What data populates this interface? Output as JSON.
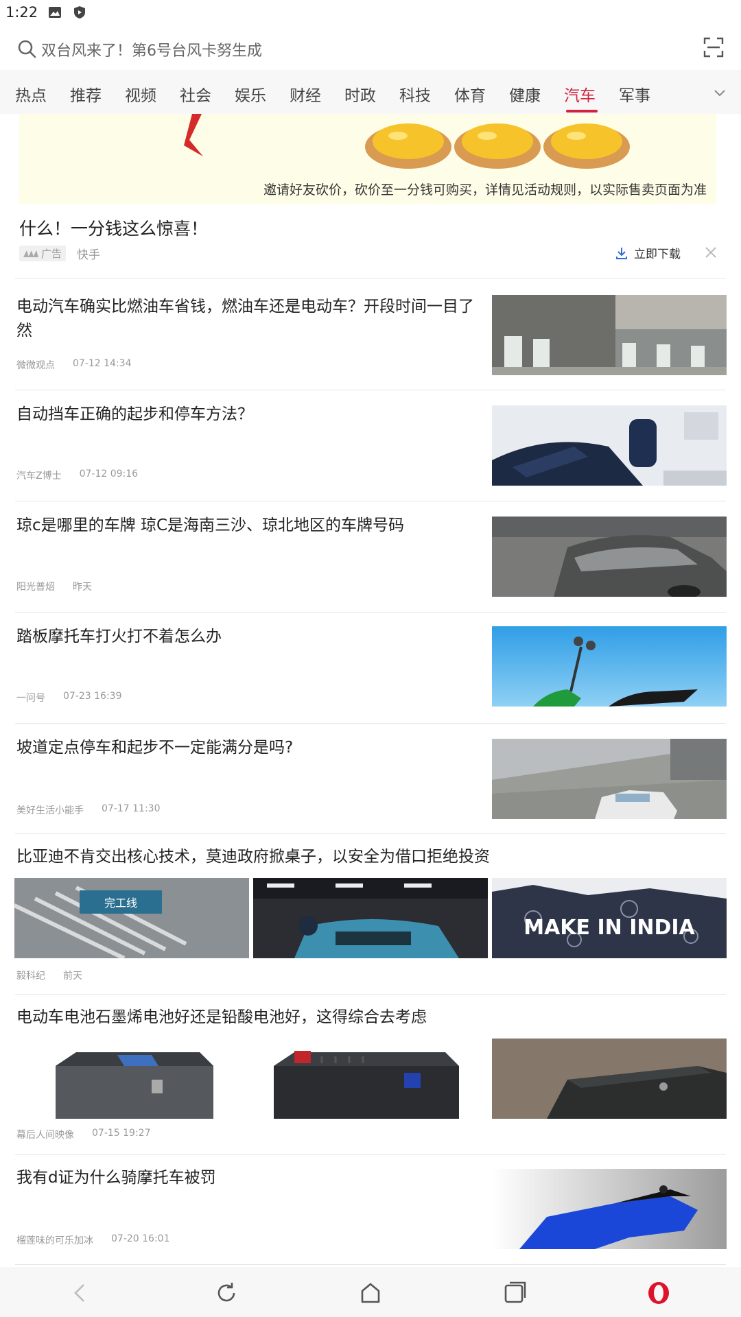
{
  "status_bar": {
    "time": "1:22",
    "icons": [
      "image-icon",
      "shield-icon"
    ]
  },
  "search": {
    "placeholder": "双台风来了！第6号台风卡努生成",
    "icon": "search-icon",
    "scan_icon": "scan-icon"
  },
  "tabs": [
    {
      "label": "热点"
    },
    {
      "label": "推荐"
    },
    {
      "label": "视频"
    },
    {
      "label": "社会"
    },
    {
      "label": "娱乐"
    },
    {
      "label": "财经"
    },
    {
      "label": "时政"
    },
    {
      "label": "科技"
    },
    {
      "label": "体育"
    },
    {
      "label": "健康"
    },
    {
      "label": "汽车",
      "active": true
    },
    {
      "label": "军事"
    }
  ],
  "accent_color": "#d0233f",
  "ad": {
    "caption": "邀请好友砍价，砍价至一分钱可购买，详情见活动规则，以实际售卖页面为准",
    "title": "什么！一分钱这么惊喜！",
    "badge": "广告",
    "source": "快手",
    "download_label": "立即下载"
  },
  "news": [
    {
      "title": "电动汽车确实比燃油车省钱，燃油车还是电动车？开段时间一目了然",
      "source": "微微观点",
      "time": "07-12 14:34"
    },
    {
      "title": "自动挡车正确的起步和停车方法？",
      "source": "汽车Z博士",
      "time": "07-12 09:16"
    },
    {
      "title": "琼c是哪里的车牌 琼C是海南三沙、琼北地区的车牌号码",
      "source": "阳光普炤",
      "time": "昨天"
    },
    {
      "title": "踏板摩托车打火打不着怎么办",
      "source": "一问号",
      "time": "07-23 16:39"
    },
    {
      "title": "坡道定点停车和起步不一定能满分是吗?",
      "source": "美好生活小能手",
      "time": "07-17 11:30"
    },
    {
      "title": "比亚迪不肯交出核心技术，莫迪政府掀桌子，以安全为借口拒绝投资",
      "source": "毅科纪",
      "time": "前天",
      "image_texts": [
        "完工线",
        "MAKE IN INDIA"
      ]
    },
    {
      "title": "电动车电池石墨烯电池好还是铅酸电池好，这得综合去考虑",
      "source": "幕后人间映像",
      "time": "07-15 19:27"
    },
    {
      "title": "我有d证为什么骑摩托车被罚",
      "source": "榴莲味的可乐加冰",
      "time": "07-20 16:01"
    }
  ],
  "bottom_nav": [
    "back-icon",
    "refresh-icon",
    "home-icon",
    "tabs-icon",
    "opera-icon"
  ]
}
